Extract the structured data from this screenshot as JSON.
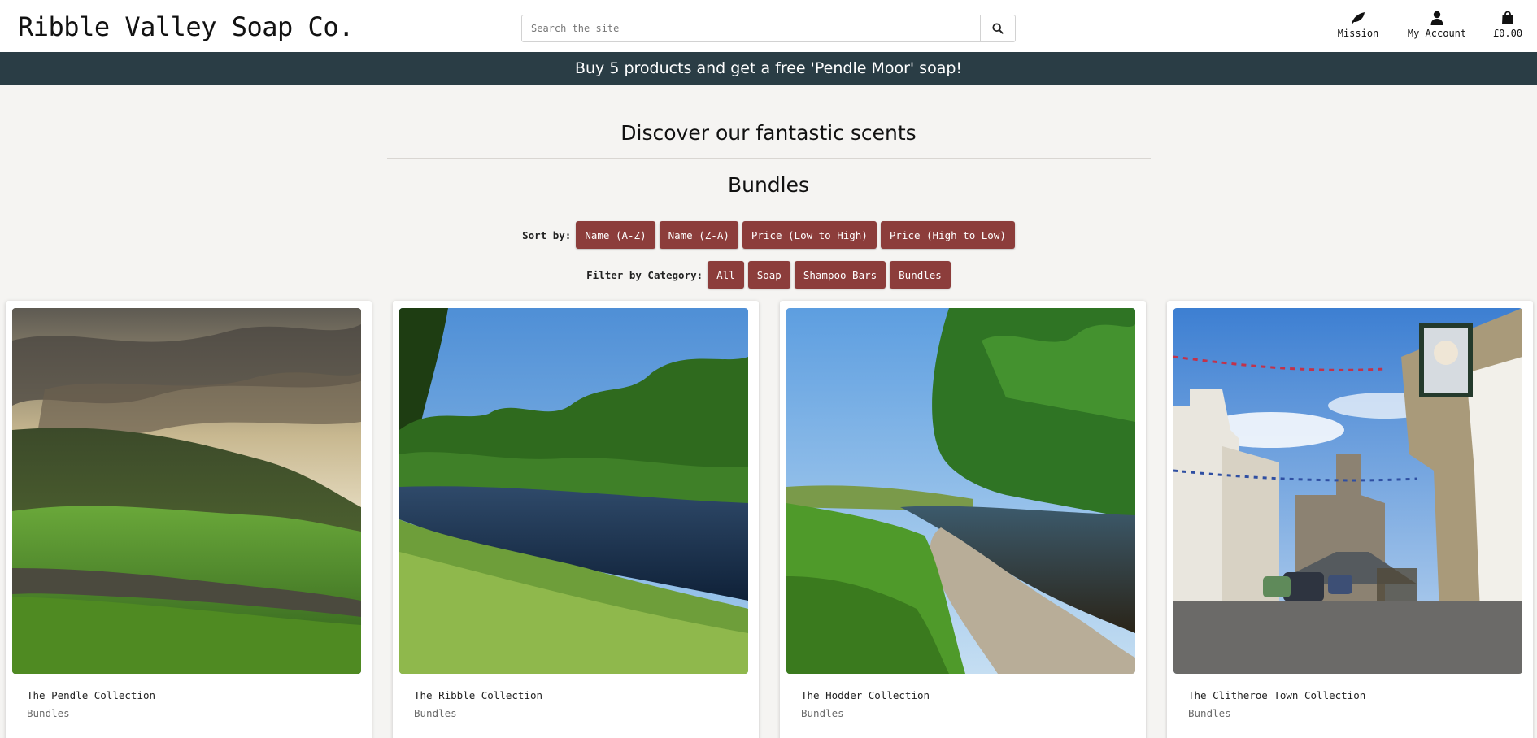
{
  "site": {
    "logo": "Ribble Valley Soap Co."
  },
  "search": {
    "placeholder": "Search the site",
    "button_icon": "search-icon"
  },
  "nav": {
    "mission_label": "Mission",
    "mission_icon": "leaf-icon",
    "account_label": "My Account",
    "account_icon": "user-icon",
    "bag_label": "£0.00",
    "bag_icon": "shopping-bag-icon"
  },
  "banner": {
    "text": "Buy 5 products and get a free 'Pendle Moor' soap!"
  },
  "main": {
    "title": "Discover our fantastic scents",
    "subtitle": "Bundles"
  },
  "sort": {
    "label": "Sort by:",
    "options": [
      "Name (A-Z)",
      "Name (Z-A)",
      "Price (Low to High)",
      "Price (High to Low)"
    ]
  },
  "filter": {
    "label": "Filter by Category:",
    "options": [
      "All",
      "Soap",
      "Shampoo Bars",
      "Bundles"
    ]
  },
  "products": [
    {
      "name": "The Pendle Collection",
      "category": "Bundles"
    },
    {
      "name": "The Ribble Collection",
      "category": "Bundles"
    },
    {
      "name": "The Hodder Collection",
      "category": "Bundles"
    },
    {
      "name": "The Clitheroe Town Collection",
      "category": "Bundles"
    }
  ],
  "colors": {
    "banner_bg": "#2a3d45",
    "button_bg": "#8c3d3b",
    "page_bg": "#f5f4f2"
  }
}
